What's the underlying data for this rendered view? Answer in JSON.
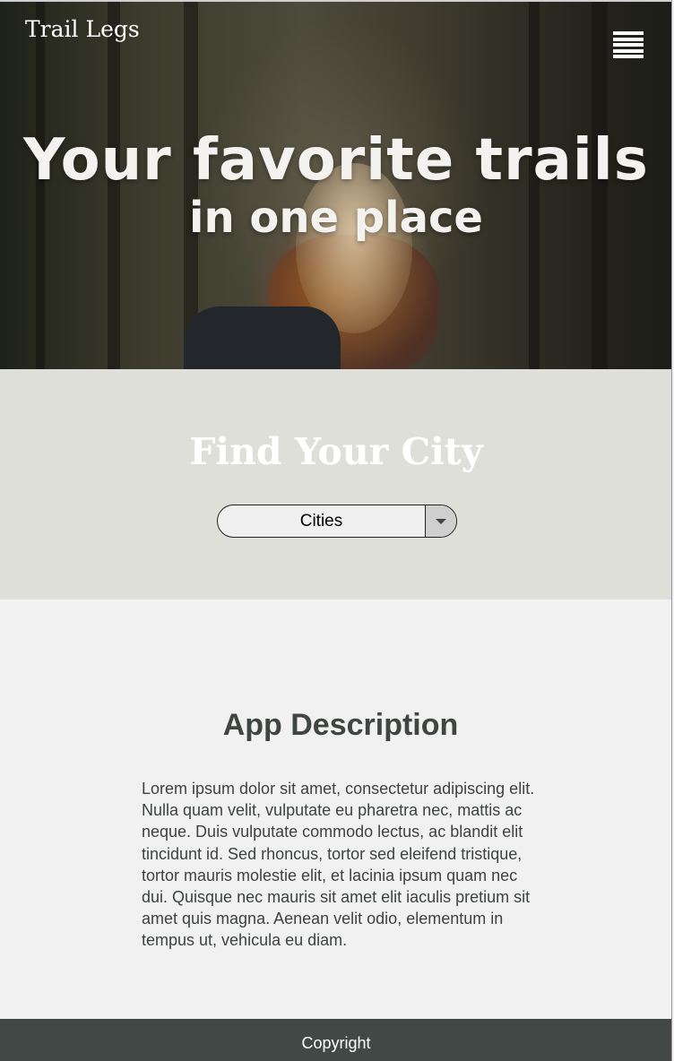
{
  "header": {
    "brand": "Trail Legs",
    "menu_icon": "hamburger-menu-icon"
  },
  "hero": {
    "title": "Your favorite trails",
    "subtitle": "in one place"
  },
  "find_city": {
    "title": "Find Your City",
    "select_value": "Cities"
  },
  "description": {
    "title": "App Description",
    "body": "Lorem ipsum dolor sit amet, consectetur adipiscing elit. Nulla quam velit, vulputate eu pharetra nec, mattis ac neque. Duis vulputate commodo lectus, ac blandit elit tincidunt id. Sed rhoncus, tortor sed eleifend tristique, tortor mauris molestie elit, et lacinia ipsum quam nec dui. Quisque nec mauris sit amet elit iaculis pretium sit amet quis magna. Aenean velit odio, elementum in tempus ut, vehicula eu diam."
  },
  "footer": {
    "text": "Copyright"
  },
  "colors": {
    "find_bg": "#dfdfda",
    "desc_bg": "#f1f1f1",
    "footer_bg": "#424845",
    "text_dark": "#3e433f"
  }
}
